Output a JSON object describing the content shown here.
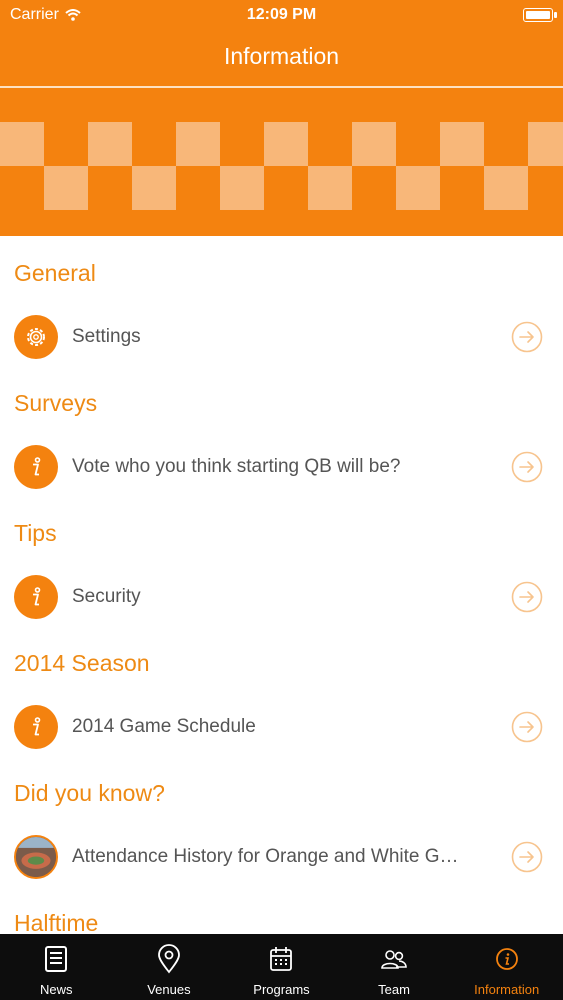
{
  "status_bar": {
    "carrier": "Carrier",
    "time": "12:09 PM",
    "battery_level": 1.0
  },
  "nav": {
    "title": "Information"
  },
  "colors": {
    "accent": "#f4820f",
    "header_text": "#ee8a14",
    "tabbar_bg": "#0d0d0d",
    "checker_light": "#f8b779"
  },
  "sections": [
    {
      "header": "General",
      "items": [
        {
          "label": "Settings",
          "icon": "gear-icon"
        }
      ]
    },
    {
      "header": "Surveys",
      "items": [
        {
          "label": "Vote who you think starting QB will be?",
          "icon": "info-icon"
        }
      ]
    },
    {
      "header": "Tips",
      "items": [
        {
          "label": "Security",
          "icon": "info-icon"
        }
      ]
    },
    {
      "header": "2014 Season",
      "items": [
        {
          "label": "2014 Game Schedule",
          "icon": "info-icon"
        }
      ]
    },
    {
      "header": "Did you know?",
      "items": [
        {
          "label": "Attendance History for Orange and White G…",
          "icon": "stadium-photo-icon"
        }
      ]
    },
    {
      "header": "Halftime",
      "items": []
    }
  ],
  "tabs": [
    {
      "label": "News",
      "icon": "news-icon",
      "active": false
    },
    {
      "label": "Venues",
      "icon": "map-pin-icon",
      "active": false
    },
    {
      "label": "Programs",
      "icon": "calendar-icon",
      "active": false
    },
    {
      "label": "Team",
      "icon": "team-icon",
      "active": false
    },
    {
      "label": "Information",
      "icon": "info-circle-icon",
      "active": true
    }
  ]
}
